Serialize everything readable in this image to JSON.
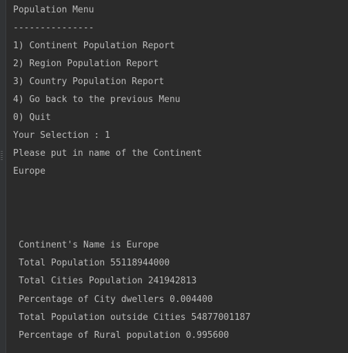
{
  "menu": {
    "title": "Population Menu",
    "separator": "---------------",
    "options": [
      "1) Continent Population Report",
      "2) Region Population Report",
      "3) Country Population Report",
      "4) Go back to the previous Menu",
      "0) Quit"
    ],
    "selection": "Your Selection : 1",
    "prompt": "Please put in name of the Continent",
    "input": "Europe"
  },
  "report": {
    "lines": [
      "Continent's Name is Europe",
      "Total Population 55118944000",
      "Total Cities Population 241942813",
      "Percentage of City dwellers 0.004400",
      "Total Population outside Cities 54877001187",
      "Percentage of Rural population 0.995600"
    ]
  },
  "colors": {
    "background": "#2b2b2b",
    "text": "#bbbbbb",
    "gutter": "#313335"
  }
}
